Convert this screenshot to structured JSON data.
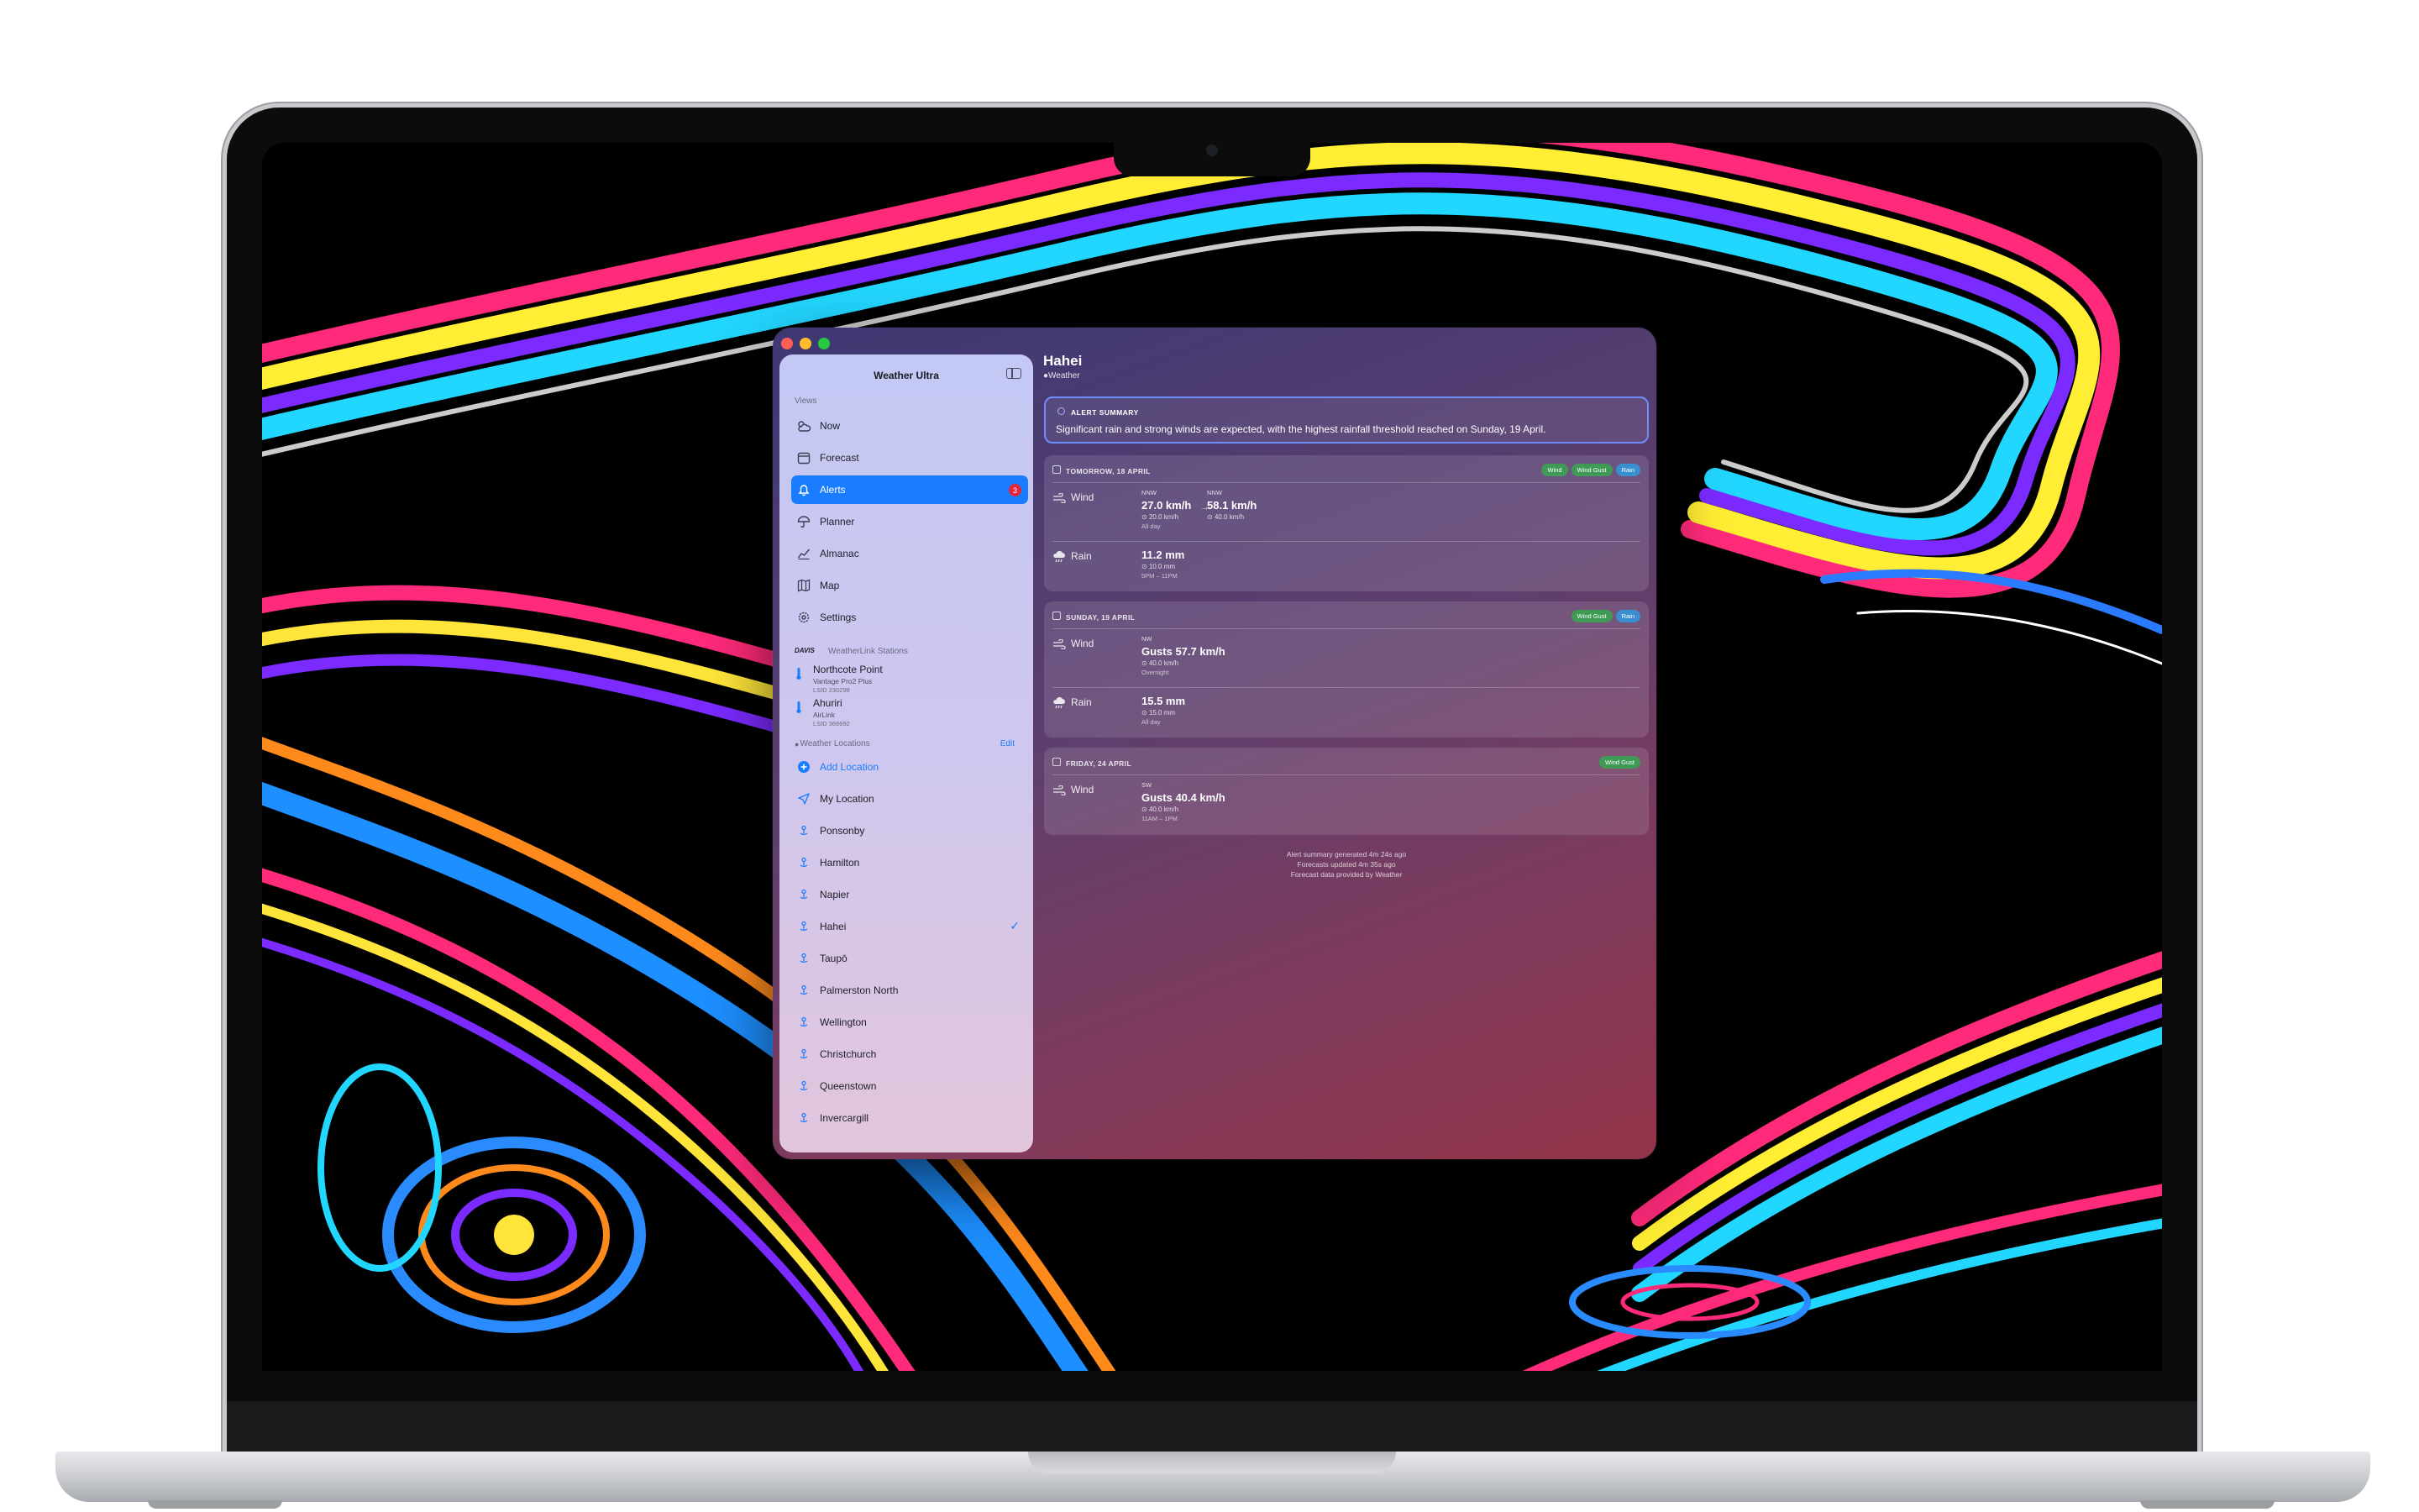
{
  "app": {
    "title": "Weather Ultra"
  },
  "sidebar": {
    "views_header": "Views",
    "views": [
      {
        "label": "Now",
        "icon": "sun-cloud-icon"
      },
      {
        "label": "Forecast",
        "icon": "calendar-icon"
      },
      {
        "label": "Alerts",
        "icon": "bell-icon",
        "badge": "3",
        "active": true
      },
      {
        "label": "Planner",
        "icon": "umbrella-icon"
      },
      {
        "label": "Almanac",
        "icon": "chart-line-icon"
      },
      {
        "label": "Map",
        "icon": "map-icon"
      },
      {
        "label": "Settings",
        "icon": "gear-icon"
      }
    ],
    "stations_header": "WeatherLink Stations",
    "stations_logo": "DAVIS",
    "stations": [
      {
        "name": "Northcote Point",
        "model": "Vantage Pro2 Plus",
        "id": "LSID 230298"
      },
      {
        "name": "Ahuriri",
        "model": "AirLink",
        "id": "LSID 366692"
      }
    ],
    "locations_header": "Weather Locations",
    "locations_edit": "Edit",
    "add_location": "Add Location",
    "my_location": "My Location",
    "locations": [
      "Ponsonby",
      "Hamilton",
      "Napier",
      "Hahei",
      "Taupō",
      "Palmerston North",
      "Wellington",
      "Christchurch",
      "Queenstown",
      "Invercargill"
    ],
    "selected_location": "Hahei"
  },
  "main": {
    "title": "Hahei",
    "subtitle": "Weather",
    "summary": {
      "header": "ALERT SUMMARY",
      "text": "Significant rain and strong winds are expected, with the highest rainfall threshold reached on Sunday, 19 April."
    },
    "days": [
      {
        "date": "TOMORROW, 18 APRIL",
        "tags": [
          "Wind",
          "Wind Gust",
          "Rain"
        ],
        "wind": {
          "label": "Wind",
          "from_dir": "NNW",
          "from_value": "27.0 km/h",
          "from_min": "20.0 km/h",
          "to_dir": "NNW",
          "to_value": "58.1 km/h",
          "to_min": "40.0 km/h",
          "when": "All day"
        },
        "rain": {
          "label": "Rain",
          "value": "11.2 mm",
          "min": "10.0 mm",
          "when": "5PM – 11PM"
        }
      },
      {
        "date": "SUNDAY, 19 APRIL",
        "tags": [
          "Wind Gust",
          "Rain"
        ],
        "wind": {
          "label": "Wind",
          "dir": "NW",
          "value": "Gusts 57.7 km/h",
          "min": "40.0 km/h",
          "when": "Overnight"
        },
        "rain": {
          "label": "Rain",
          "value": "15.5 mm",
          "min": "15.0 mm",
          "when": "All day"
        }
      },
      {
        "date": "FRIDAY, 24 APRIL",
        "tags": [
          "Wind Gust"
        ],
        "wind": {
          "label": "Wind",
          "dir": "SW",
          "value": "Gusts 40.4 km/h",
          "min": "40.0 km/h",
          "when": "11AM – 1PM"
        }
      }
    ],
    "footer": [
      "Alert summary generated 4m 24s ago",
      "Forecasts updated 4m 35s ago",
      "Forecast data provided by  Weather"
    ]
  },
  "colors": {
    "accent": "#1a7dff",
    "badge": "#e3263f",
    "tag_green": "#3f9a55",
    "tag_blue": "#3a8fd0",
    "summary_border": "#6d8cff"
  }
}
